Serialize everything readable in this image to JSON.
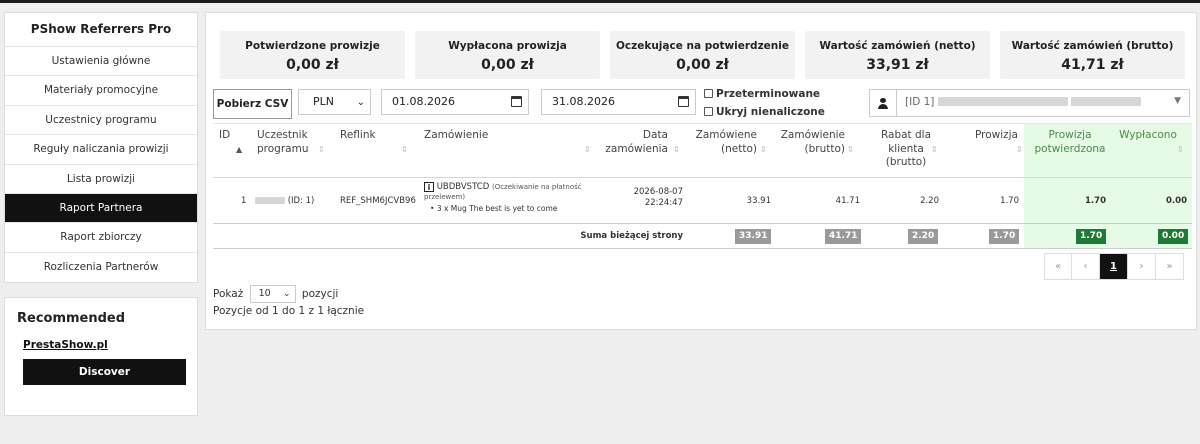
{
  "sidebar": {
    "title": "PShow Referrers Pro",
    "items": [
      {
        "label": "Ustawienia główne"
      },
      {
        "label": "Materiały promocyjne"
      },
      {
        "label": "Uczestnicy programu"
      },
      {
        "label": "Reguły naliczania prowizji"
      },
      {
        "label": "Lista prowizji"
      },
      {
        "label": "Raport Partnera",
        "active": true
      },
      {
        "label": "Raport zbiorczy"
      },
      {
        "label": "Rozliczenia Partnerów"
      }
    ]
  },
  "recommended": {
    "title": "Recommended",
    "link": "PrestaShow.pl",
    "button": "Discover"
  },
  "stats": [
    {
      "label": "Potwierdzone prowizje",
      "value": "0,00 zł"
    },
    {
      "label": "Wypłacona prowizja",
      "value": "0,00 zł"
    },
    {
      "label": "Oczekujące na potwierdzenie",
      "value": "0,00 zł"
    },
    {
      "label": "Wartość zamówień (netto)",
      "value": "33,91 zł"
    },
    {
      "label": "Wartość zamówień (brutto)",
      "value": "41,71 zł"
    }
  ],
  "toolbar": {
    "csv_button": "Pobierz CSV",
    "currency": "PLN",
    "date_from": "01.08.2026",
    "date_to": "31.08.2026",
    "cb_expired": "Przeterminowane",
    "cb_hide": "Ukryj nienaliczone",
    "user_prefix": "[ID 1]"
  },
  "table": {
    "headers": {
      "id": "ID",
      "participant": [
        "Uczestnik",
        "programu"
      ],
      "reflink": "Reflink",
      "order": "Zamówienie",
      "date": [
        "Data",
        "zamówienia"
      ],
      "net": [
        "Zamówiene",
        "(netto)"
      ],
      "gross": [
        "Zamówienie",
        "(brutto)"
      ],
      "discount": [
        "Rabat dla",
        "klienta",
        "(brutto)"
      ],
      "commission": "Prowizja",
      "confirmed": [
        "Prowizja",
        "potwierdzona"
      ],
      "paid": "Wypłacono"
    },
    "row": {
      "id": "1",
      "participant_suffix": "(ID: 1)",
      "reflink": "REF_SHM6JCVB96",
      "order_ref": "UBDBVSTCD",
      "order_status": "(Oczekiwanie na płatność przelewem)",
      "order_item": "3 x Mug The best is yet to come",
      "date": "2026-08-07",
      "time": "22:24:47",
      "net": "33.91",
      "gross": "41.71",
      "discount": "2.20",
      "commission": "1.70",
      "confirmed": "1.70",
      "paid": "0.00"
    },
    "sum": {
      "label": "Suma bieżącej strony",
      "net": "33.91",
      "gross": "41.71",
      "discount": "2.20",
      "commission": "1.70",
      "confirmed": "1.70",
      "paid": "0.00"
    }
  },
  "pagination": {
    "first": "«",
    "prev": "‹",
    "current": "1",
    "next": "›",
    "last": "»"
  },
  "footer": {
    "show_pre": "Pokaż",
    "page_size": "10",
    "show_post": "pozycji",
    "info": "Pozycje od 1 do 1 z 1 łącznie"
  },
  "colors": {
    "accent_dark": "#111111",
    "confirmed_bg": "#e6fbe6",
    "badge_green": "#1e7a37",
    "badge_gray": "#9a9a9a"
  }
}
